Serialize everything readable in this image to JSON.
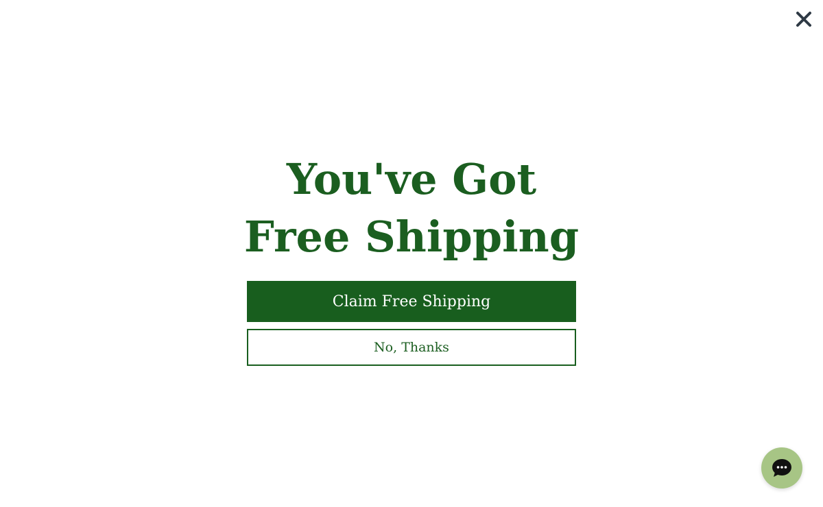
{
  "close": {
    "icon": "close-icon",
    "color": "#2f3a45"
  },
  "popup": {
    "headline_line1": "You've Got",
    "headline_line2": "Free Shipping",
    "claim_label": "Claim Free Shipping",
    "decline_label": "No, Thanks"
  },
  "chat": {
    "icon": "chat-bubble-icon",
    "color": "#a7c585"
  },
  "colors": {
    "brand_green": "#185e1e",
    "background": "#ffffff"
  }
}
